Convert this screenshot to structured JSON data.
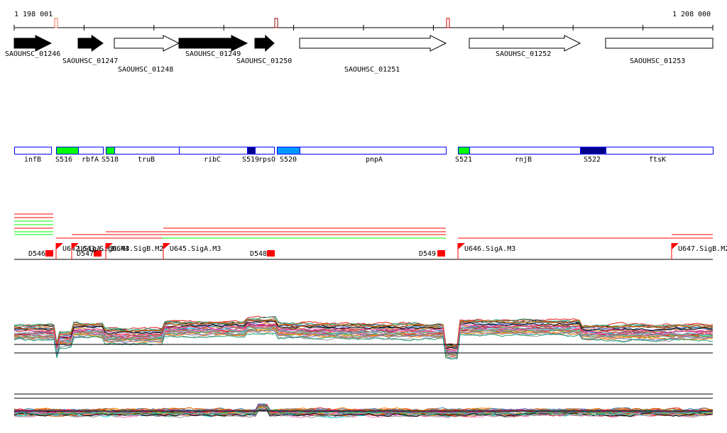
{
  "axis": {
    "start_label": "1 198 001",
    "end_label": "1 208 000"
  },
  "genes": [
    {
      "label": "SAOUHSC_01246",
      "filled": true
    },
    {
      "label": "SAOUHSC_01247",
      "filled": true
    },
    {
      "label": "SAOUHSC_01248",
      "filled": false
    },
    {
      "label": "SAOUHSC_01249",
      "filled": true
    },
    {
      "label": "SAOUHSC_01250",
      "filled": true
    },
    {
      "label": "SAOUHSC_01251",
      "filled": false
    },
    {
      "label": "SAOUHSC_01252",
      "filled": false
    },
    {
      "label": "SAOUHSC_01253",
      "filled": false
    }
  ],
  "segments": [
    {
      "label": "infB",
      "color": "#ffffff"
    },
    {
      "label": "S516",
      "color": "#00ff00"
    },
    {
      "label": "rbfA",
      "color": "#ffffff"
    },
    {
      "label": "S518",
      "color": "#00ff00"
    },
    {
      "label": "truB",
      "color": "#ffffff"
    },
    {
      "label": "ribC",
      "color": "#ffffff"
    },
    {
      "label": "S519",
      "color": "#000088"
    },
    {
      "label": "rpsO",
      "color": "#ffffff"
    },
    {
      "label": "S520",
      "color": "#0099ff"
    },
    {
      "label": "pnpA",
      "color": "#ffffff"
    },
    {
      "label": "S521",
      "color": "#00ff00"
    },
    {
      "label": "rnjB",
      "color": "#ffffff"
    },
    {
      "label": "S522",
      "color": "#000088"
    },
    {
      "label": "ftsK",
      "color": "#ffffff"
    }
  ],
  "terminators": [
    "D546",
    "D547",
    "D548",
    "D549"
  ],
  "promoters": [
    "U642.SigA.M3",
    "U643.SigA.M3",
    "U644.SigB.M2",
    "U645.SigA.M3",
    "U646.SigA.M3",
    "U647.SigB.M2"
  ],
  "colors": {
    "segment_border": "#0000ff",
    "feature": "#ff0000",
    "green": "#00ff00"
  }
}
